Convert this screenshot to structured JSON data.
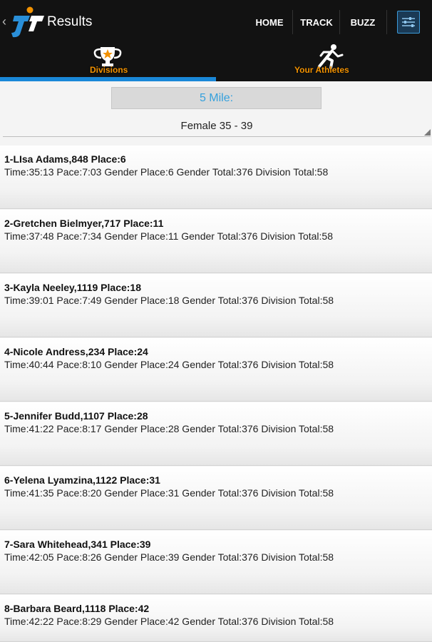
{
  "header": {
    "back_glyph": "‹",
    "title": "Results",
    "nav": [
      {
        "label": "HOME"
      },
      {
        "label": "TRACK"
      },
      {
        "label": "BUZZ"
      }
    ]
  },
  "tabs": [
    {
      "label": "Divisions",
      "icon": "trophy-icon",
      "selected": true
    },
    {
      "label": "Your Athletes",
      "icon": "runner-icon",
      "selected": false
    }
  ],
  "colors": {
    "accent_blue": "#1a88d8",
    "tab_label_orange": "#f39200",
    "bar_background": "#121212"
  },
  "race": {
    "label": "5 Mile:"
  },
  "division": {
    "label": "Female 35 - 39"
  },
  "results": [
    {
      "name": "1-LIsa Adams,848 Place:6",
      "detail": "Time:35:13 Pace:7:03 Gender Place:6 Gender Total:376 Division Total:58"
    },
    {
      "name": "2-Gretchen Bielmyer,717 Place:11",
      "detail": "Time:37:48 Pace:7:34 Gender Place:11 Gender Total:376 Division Total:58"
    },
    {
      "name": "3-Kayla Neeley,1119 Place:18",
      "detail": "Time:39:01 Pace:7:49 Gender Place:18 Gender Total:376 Division Total:58"
    },
    {
      "name": "4-Nicole Andress,234 Place:24",
      "detail": "Time:40:44 Pace:8:10 Gender Place:24 Gender Total:376 Division Total:58"
    },
    {
      "name": "5-Jennifer Budd,1107 Place:28",
      "detail": "Time:41:22 Pace:8:17 Gender Place:28 Gender Total:376 Division Total:58"
    },
    {
      "name": "6-Yelena Lyamzina,1122 Place:31",
      "detail": "Time:41:35 Pace:8:20 Gender Place:31 Gender Total:376 Division Total:58"
    },
    {
      "name": "7-Sara Whitehead,341 Place:39",
      "detail": "Time:42:05 Pace:8:26 Gender Place:39 Gender Total:376 Division Total:58"
    },
    {
      "name": "8-Barbara Beard,1118 Place:42",
      "detail": "Time:42:22 Pace:8:29 Gender Place:42 Gender Total:376 Division Total:58"
    }
  ]
}
